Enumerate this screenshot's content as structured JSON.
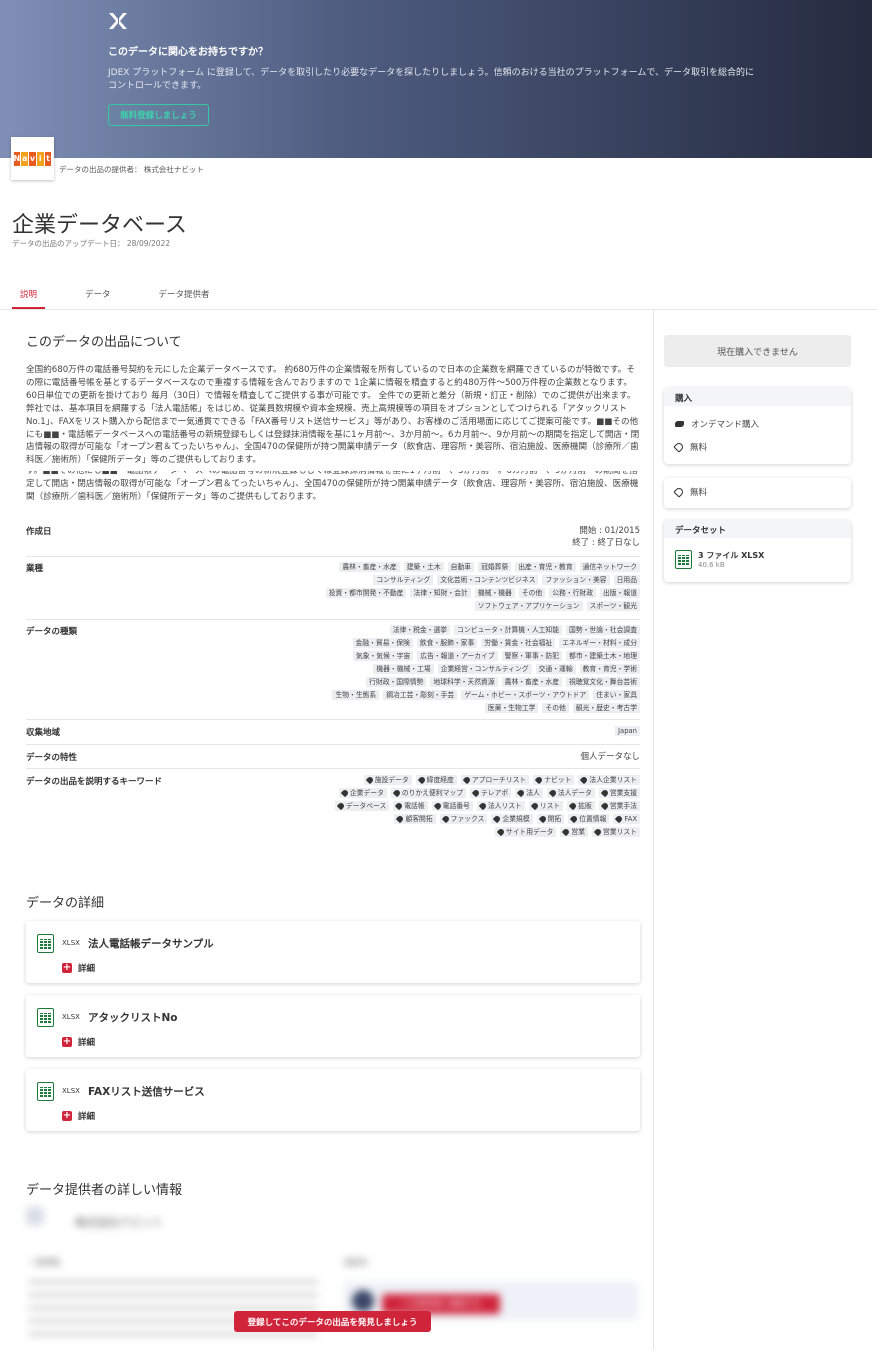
{
  "banner": {
    "title": "このデータに関心をお持ちですか？",
    "description": "JDEX プラットフォーム に登録して、データを取引したり必要なデータを探したりしましょう。信頼のおける当社のプラットフォームで、データ取引を総合的にコントロールできます。",
    "signup_label": "無料登録しましょう"
  },
  "provider": {
    "label": "データの出品の提供者： 株式会社ナビット",
    "logo_letters": [
      "N",
      "a",
      "v",
      "i",
      "t"
    ]
  },
  "page": {
    "title": "企業データベース",
    "update_date": "データの出品のアップデート日： 28/09/2022"
  },
  "tabs": [
    {
      "label": "説明"
    },
    {
      "label": "データ"
    },
    {
      "label": "データ提供者"
    }
  ],
  "about": {
    "title": "このデータの出品について",
    "text": "全国約680万件の電話番号契約を元にした企業データベースです。 約680万件の企業情報を所有しているので日本の企業数を網羅できているのが特徴です。その際に電話番号帳を基とするデータベースなので重複する情報を含んでおりますので 1企業に情報を精査すると約480万件〜500万件程の企業数となります。 60日単位での更新を掛けており 毎月（30日）で情報を精査してご提供する事が可能です。 全件での更新と差分（新規・訂正・削除）でのご提供が出来ます。 弊社では、基本項目を網羅する「法人電話帳」をはじめ、従業員数規模や資本金規模、売上高規模等の項目をオプションとしてつけられる「アタックリストNo.1」、FAXをリスト購入から配信まで一気通貫でできる「FAX番号リスト送信サービス」等があり、お客様のご活用場面に応じてご提案可能です。■■その他にも■■・電話帳データベースへの電話番号の新規登録もしくは登録抹消情報を基に1ヶ月前〜、3か月前〜。6カ月前〜、9か月前〜の期間を指定して開店・閉店情報の取得が可能な「オープン君＆てったいちゃん」、全国470の保健所が持つ開業申請データ（飲食店、理容所・美容所、宿泊施設、医療機関（診療所／歯科医／施術所）「保健所データ」等のご提供もしております。",
    "text_repeat": "す。■■その他にも■■・電話帳データベースへの電話番号の新規登録もしくは登録抹消情報を基に1ヶ月前〜、3か月前〜。6カ月前〜、9か月前〜の期間を指定して開店・閉店情報の取得が可能な「オープン君＆てったいちゃん」、全国470の保健所が持つ開業申請データ（飲食店、理容所・美容所、宿泊施設、医療機関（診療所／歯科医／施術所）「保健所データ」等のご提供もしております。"
  },
  "props": {
    "created": {
      "label": "作成日",
      "start": "開始 : 01/2015",
      "end": "終了 : 終了日なし"
    },
    "industry": {
      "label": "業種",
      "tags": [
        "農林・畜産・水産",
        "建築・土木",
        "自動車",
        "冠婚葬祭",
        "出産・育児・教育",
        "通信ネットワーク",
        "コンサルティング",
        "文化芸術・コンテンツビジネス",
        "ファッション・美容",
        "日用品",
        "投資・都市開発・不動産",
        "法律・知財・会計",
        "機械・機器",
        "その他",
        "公務・行財政",
        "出版・報道",
        "ソフトウェア・アプリケーション",
        "スポーツ・観光"
      ]
    },
    "data_type": {
      "label": "データの種類",
      "tags": [
        "法律・税金・選挙",
        "コンピュータ・計算機・人工知能",
        "国勢・世論・社会調査",
        "金融・貿易・保険",
        "飲食・服飾・家事",
        "労働・賃金・社会福祉",
        "エネルギー・材料・成分",
        "気象・気候・宇宙",
        "広告・報道・アーカイブ",
        "警察・軍事・防犯",
        "都市・建築土木・地理",
        "機器・機械・工場",
        "企業経営・コンサルティング",
        "交通・運輸",
        "教育・育児・学術",
        "行財政・国際情勢",
        "地球科学・天然資源",
        "農林・畜産・水産",
        "視聴覚文化・舞台芸術",
        "生物・生態系",
        "鋼冶工芸・彫刻・手芸",
        "ゲーム・ホビー・スポーツ・アウトドア",
        "住まい・家具",
        "医薬・生物工学",
        "その他",
        "観光・歴史・考古学"
      ]
    },
    "region": {
      "label": "収集地域",
      "tags": [
        "Japan"
      ]
    },
    "characteristic": {
      "label": "データの特性",
      "value": "個人データなし"
    },
    "keywords": {
      "label": "データの出品を説明するキーワード",
      "tags": [
        "施設データ",
        "緯度経度",
        "アプローチリスト",
        "ナビット",
        "法人企業リスト",
        "企業データ",
        "のりかえ便利マップ",
        "テレアポ",
        "法人",
        "法人データ",
        "営業支援",
        "データベース",
        "電話帳",
        "電話番号",
        "法人リスト",
        "リスト",
        "拡販",
        "営業手法",
        "顧客開拓",
        "ファックス",
        "企業規模",
        "開拓",
        "位置情報",
        "FAX",
        "サイト用データ",
        "営業",
        "営業リスト"
      ]
    }
  },
  "details": {
    "title": "データの詳細",
    "files": [
      {
        "format": "XLSX",
        "name": "法人電話帳データサンプル",
        "detail_label": "詳細"
      },
      {
        "format": "XLSX",
        "name": "アタックリストNo",
        "detail_label": "詳細"
      },
      {
        "format": "XLSX",
        "name": "FAXリスト送信サービス",
        "detail_label": "詳細"
      }
    ]
  },
  "provider_info": {
    "title": "データ提供者の詳しい情報",
    "blurred_name": "株式会社ナビット",
    "blurred_col1": "一般情報",
    "blurred_col2": "連絡先",
    "blurred_btn": "この提供者に連絡する"
  },
  "sidebar": {
    "unavailable": "現在購入できません",
    "purchase": {
      "title": "購入",
      "on_demand": "オンデマンド購入",
      "price": "無料"
    },
    "price2": "無料",
    "dataset": {
      "title": "データセット",
      "files": "3 ファイル XLSX",
      "size": "40.6 kB"
    }
  },
  "cta": {
    "label": "登録してこのデータの出品を発見しましょう"
  }
}
